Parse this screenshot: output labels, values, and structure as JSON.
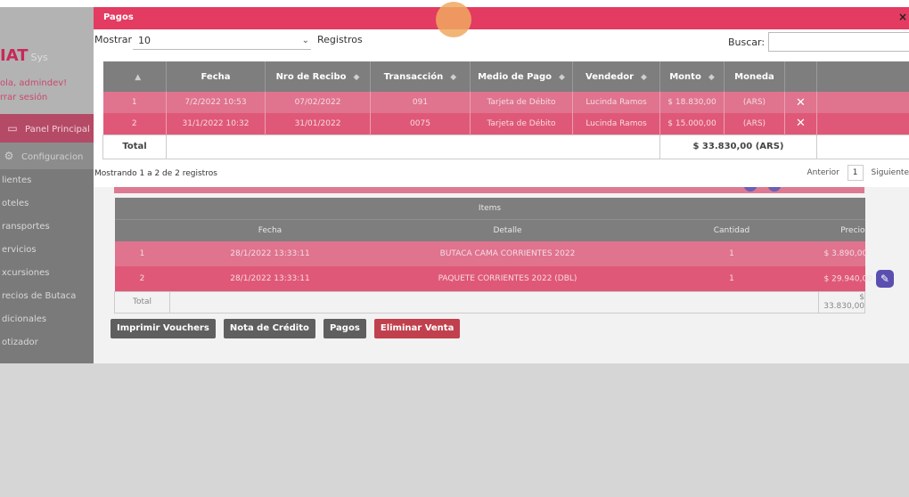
{
  "sidebar": {
    "brand": "IAT",
    "brand_suffix": "Sys",
    "greeting": "ola, admindev!",
    "logout": "rrar sesión",
    "items": [
      {
        "label": "Panel Principal",
        "icon": "monitor-icon"
      },
      {
        "label": "Configuracion",
        "icon": "settings-icon"
      },
      {
        "label": "lientes"
      },
      {
        "label": "oteles"
      },
      {
        "label": "ransportes"
      },
      {
        "label": "ervicios"
      },
      {
        "label": "xcursiones"
      },
      {
        "label": "recios de Butaca"
      },
      {
        "label": "dicionales"
      },
      {
        "label": "otizador"
      }
    ]
  },
  "modal": {
    "title": "Pagos",
    "close": "×",
    "show_label": "Mostrar",
    "show_value": "10",
    "records_label": "Registros",
    "search_label": "Buscar:",
    "search_value": "",
    "columns": [
      "",
      "Fecha",
      "Nro de Recibo",
      "Transacción",
      "Medio de Pago",
      "Vendedor",
      "Monto",
      "Moneda",
      ""
    ],
    "rows": [
      {
        "n": "1",
        "fecha": "7/2/2022 10:53",
        "recibo": "07/02/2022",
        "transaccion": "091",
        "medio": "Tarjeta de Débito",
        "vendedor": "Lucinda Ramos",
        "monto": "$ 18.830,00",
        "moneda": "(ARS)"
      },
      {
        "n": "2",
        "fecha": "31/1/2022 10:32",
        "recibo": "31/01/2022",
        "transaccion": "0075",
        "medio": "Tarjeta de Débito",
        "vendedor": "Lucinda Ramos",
        "monto": "$ 15.000,00",
        "moneda": "(ARS)"
      }
    ],
    "total_label": "Total",
    "total_value": "$ 33.830,00 (ARS)",
    "info": "Mostrando 1 a 2 de 2 registros",
    "prev": "Anterior",
    "page": "1",
    "next": "Siguiente"
  },
  "items": {
    "title": "Items",
    "columns": [
      "",
      "Fecha",
      "Detalle",
      "Cantidad",
      "Precio"
    ],
    "rows": [
      {
        "n": "1",
        "fecha": "28/1/2022 13:33:11",
        "detalle": "BUTACA CAMA CORRIENTES 2022",
        "cantidad": "1",
        "precio": "$ 3.890,00"
      },
      {
        "n": "2",
        "fecha": "28/1/2022 13:33:11",
        "detalle": "PAQUETE CORRIENTES 2022 (DBL)",
        "cantidad": "1",
        "precio": "$ 29.940,00"
      }
    ],
    "total_label": "Total",
    "total_value": "$ 33.830,00"
  },
  "actions": {
    "print": "Imprimir Vouchers",
    "credit": "Nota de Crédito",
    "payments": "Pagos",
    "delete": "Eliminar Venta"
  },
  "colors": {
    "accent": "#e33b61",
    "row_light": "#e0738e",
    "row_dark": "#e05877",
    "danger": "#c0414d"
  }
}
